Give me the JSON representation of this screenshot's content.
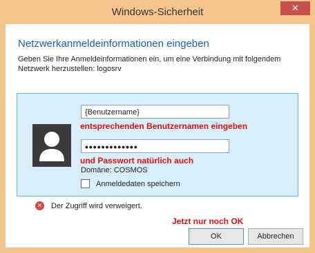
{
  "window": {
    "title": "Windows-Sicherheit",
    "close_label": "✕"
  },
  "dialog": {
    "heading": "Netzwerkanmeldeinformationen eingeben",
    "description": "Geben Sie Ihre Anmeldeinformationen ein, um eine Verbindung mit folgendem Netzwerk herzustellen: logosrv"
  },
  "credentials": {
    "username_value": "{Benutzername}",
    "password_value": "•••••••••••••",
    "domain": "Domäne: COSMOS",
    "remember_label": "Anmeldedaten speichern",
    "remember_checked": false
  },
  "annotations": {
    "user": "entsprechenden Benutzernamen eingeben",
    "pass": "und Passwort natürlich auch",
    "ok": "Jetzt nur noch OK",
    "color": "#e01010"
  },
  "error": {
    "message": "Der Zugriff wird verweigert.",
    "icon": "error-icon"
  },
  "buttons": {
    "ok": "OK",
    "cancel": "Abbrechen"
  },
  "colors": {
    "titlebar": "#f7c68f",
    "close": "#c7504a",
    "heading": "#1f5fa7",
    "panel": "#d9eefb",
    "panel_border": "#66b6e4"
  }
}
